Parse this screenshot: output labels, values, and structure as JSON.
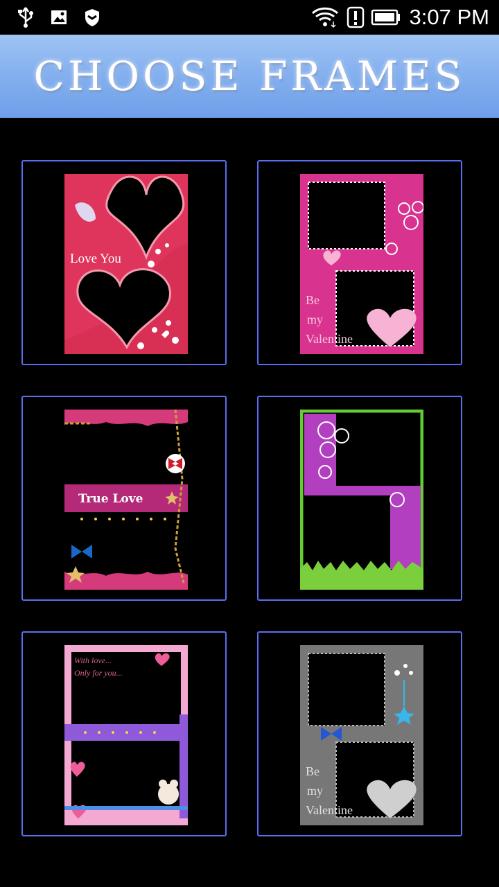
{
  "status_bar": {
    "time": "3:07 PM"
  },
  "header": {
    "title": "CHOOSE FRAMES"
  },
  "frames": [
    {
      "id": "frame-1",
      "text": "Love You"
    },
    {
      "id": "frame-2",
      "text_lines": [
        "Be",
        "my",
        "Valentine"
      ]
    },
    {
      "id": "frame-3",
      "text": "True Love"
    },
    {
      "id": "frame-4"
    },
    {
      "id": "frame-5",
      "text_lines": [
        "With love...",
        "Only for you..."
      ]
    },
    {
      "id": "frame-6",
      "text_lines": [
        "Be",
        "my",
        "Valentine"
      ]
    }
  ],
  "colors": {
    "header_bg": "#86b1ef",
    "tile_border": "#5a6ff0",
    "background": "#000000"
  }
}
